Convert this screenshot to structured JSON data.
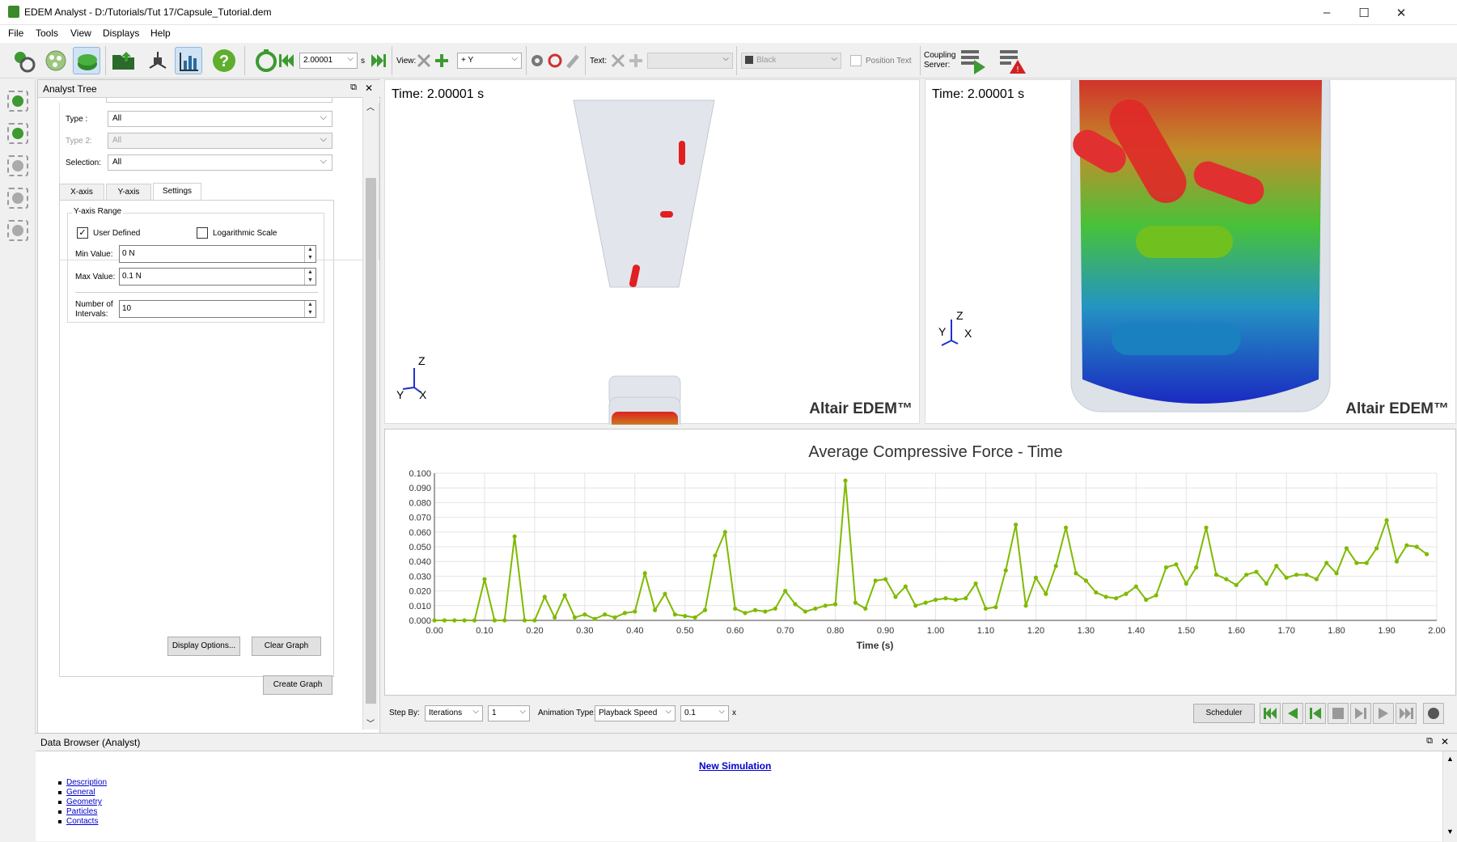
{
  "window": {
    "title": "EDEM Analyst - D:/Tutorials/Tut 17/Capsule_Tutorial.dem",
    "minimize": "–",
    "maximize": "☐",
    "close": "✕"
  },
  "menu": [
    "File",
    "Tools",
    "View",
    "Displays",
    "Help"
  ],
  "toolbar": {
    "time_value": "2.00001",
    "time_unit": "s",
    "view_label": "View:",
    "view_value": "+ Y",
    "text_label": "Text:",
    "text_value": "",
    "color_value": "Black",
    "position_text": "Position Text",
    "coupling_label_1": "Coupling",
    "coupling_label_2": "Server:"
  },
  "tree": {
    "title": "Analyst Tree",
    "fields": [
      {
        "label": "Type :",
        "value": "All"
      },
      {
        "label": "Type 2:",
        "value": "All"
      },
      {
        "label": "Selection:",
        "value": "All"
      }
    ],
    "tabs": [
      "X-axis",
      "Y-axis",
      "Settings"
    ],
    "group_title": "Y-axis Range",
    "user_defined": "User Defined",
    "log_scale": "Logarithmic Scale",
    "min_label": "Min Value:",
    "min_value": "0 N",
    "max_label": "Max Value:",
    "max_value": "0.1 N",
    "intervals_label_1": "Number of",
    "intervals_label_2": "Intervals:",
    "intervals_value": "10",
    "display_options": "Display Options...",
    "clear_graph": "Clear Graph",
    "create_graph": "Create Graph"
  },
  "views": [
    {
      "time": "Time: 2.00001 s",
      "brand": "Altair EDEM™",
      "axis_z": "Z",
      "axis_y": "Y",
      "axis_x": "X"
    },
    {
      "time": "Time: 2.00001 s",
      "brand": "Altair EDEM™",
      "axis_z": "Z",
      "axis_y": "Y",
      "axis_x": "X"
    }
  ],
  "controls": {
    "step_by_label": "Step By:",
    "step_by_value": "Iterations",
    "step_value": "1",
    "animation_type_label": "Animation Type:",
    "animation_type_value": "Playback Speed",
    "speed_value": "0.1",
    "speed_unit": "x",
    "scheduler": "Scheduler"
  },
  "data_browser": {
    "title": "Data Browser (Analyst)",
    "heading": "New Simulation",
    "links": [
      "Description",
      "General",
      "Geometry",
      "Particles",
      "Contacts"
    ]
  },
  "colors": {
    "series": "#7fba00",
    "accent": "#0000cc"
  },
  "chart_data": {
    "type": "line",
    "title": "Average Compressive Force - Time",
    "xlabel": "Time (s)",
    "ylabel": "",
    "xlim": [
      0,
      2.0
    ],
    "ylim": [
      0,
      0.1
    ],
    "xticks": [
      "0.00",
      "0.10",
      "0.20",
      "0.30",
      "0.40",
      "0.50",
      "0.60",
      "0.70",
      "0.80",
      "0.90",
      "1.00",
      "1.10",
      "1.20",
      "1.30",
      "1.40",
      "1.50",
      "1.60",
      "1.70",
      "1.80",
      "1.90",
      "2.00"
    ],
    "yticks": [
      "0.000",
      "0.010",
      "0.020",
      "0.030",
      "0.040",
      "0.050",
      "0.060",
      "0.070",
      "0.080",
      "0.090",
      "0.100"
    ],
    "grid": true,
    "series": [
      {
        "x": [
          0.0,
          0.02,
          0.04,
          0.06,
          0.08,
          0.1,
          0.12,
          0.14,
          0.16,
          0.18,
          0.2,
          0.22,
          0.24,
          0.26,
          0.28,
          0.3,
          0.32,
          0.34,
          0.36,
          0.38,
          0.4,
          0.42,
          0.44,
          0.46,
          0.48,
          0.5,
          0.52,
          0.54,
          0.56,
          0.58,
          0.6,
          0.62,
          0.64,
          0.66,
          0.68,
          0.7,
          0.72,
          0.74,
          0.76,
          0.78,
          0.8,
          0.82,
          0.84,
          0.86,
          0.88,
          0.9,
          0.92,
          0.94,
          0.96,
          0.98,
          1.0,
          1.02,
          1.04,
          1.06,
          1.08,
          1.1,
          1.12,
          1.14,
          1.16,
          1.18,
          1.2,
          1.22,
          1.24,
          1.26,
          1.28,
          1.3,
          1.32,
          1.34,
          1.36,
          1.38,
          1.4,
          1.42,
          1.44,
          1.46,
          1.48,
          1.5,
          1.52,
          1.54,
          1.56,
          1.58,
          1.6,
          1.62,
          1.64,
          1.66,
          1.68,
          1.7,
          1.72,
          1.74,
          1.76,
          1.78,
          1.8,
          1.82,
          1.84,
          1.86,
          1.88,
          1.9,
          1.92,
          1.94,
          1.96,
          1.98
        ],
        "values": [
          0.0,
          0.0,
          0.0,
          0.0,
          0.0,
          0.028,
          0.0,
          0.0,
          0.057,
          0.0,
          0.0,
          0.016,
          0.002,
          0.017,
          0.002,
          0.004,
          0.001,
          0.004,
          0.002,
          0.005,
          0.006,
          0.032,
          0.007,
          0.018,
          0.004,
          0.003,
          0.002,
          0.007,
          0.044,
          0.06,
          0.008,
          0.005,
          0.007,
          0.006,
          0.008,
          0.02,
          0.011,
          0.006,
          0.008,
          0.01,
          0.011,
          0.095,
          0.012,
          0.008,
          0.027,
          0.028,
          0.016,
          0.023,
          0.01,
          0.012,
          0.014,
          0.015,
          0.014,
          0.015,
          0.025,
          0.008,
          0.009,
          0.034,
          0.065,
          0.01,
          0.029,
          0.018,
          0.037,
          0.063,
          0.032,
          0.027,
          0.019,
          0.016,
          0.015,
          0.018,
          0.023,
          0.014,
          0.017,
          0.036,
          0.038,
          0.025,
          0.036,
          0.063,
          0.031,
          0.028,
          0.024,
          0.031,
          0.033,
          0.025,
          0.037,
          0.029,
          0.031,
          0.031,
          0.028,
          0.039,
          0.032,
          0.049,
          0.039,
          0.039,
          0.049,
          0.068,
          0.04,
          0.051,
          0.05,
          0.045
        ]
      }
    ]
  }
}
